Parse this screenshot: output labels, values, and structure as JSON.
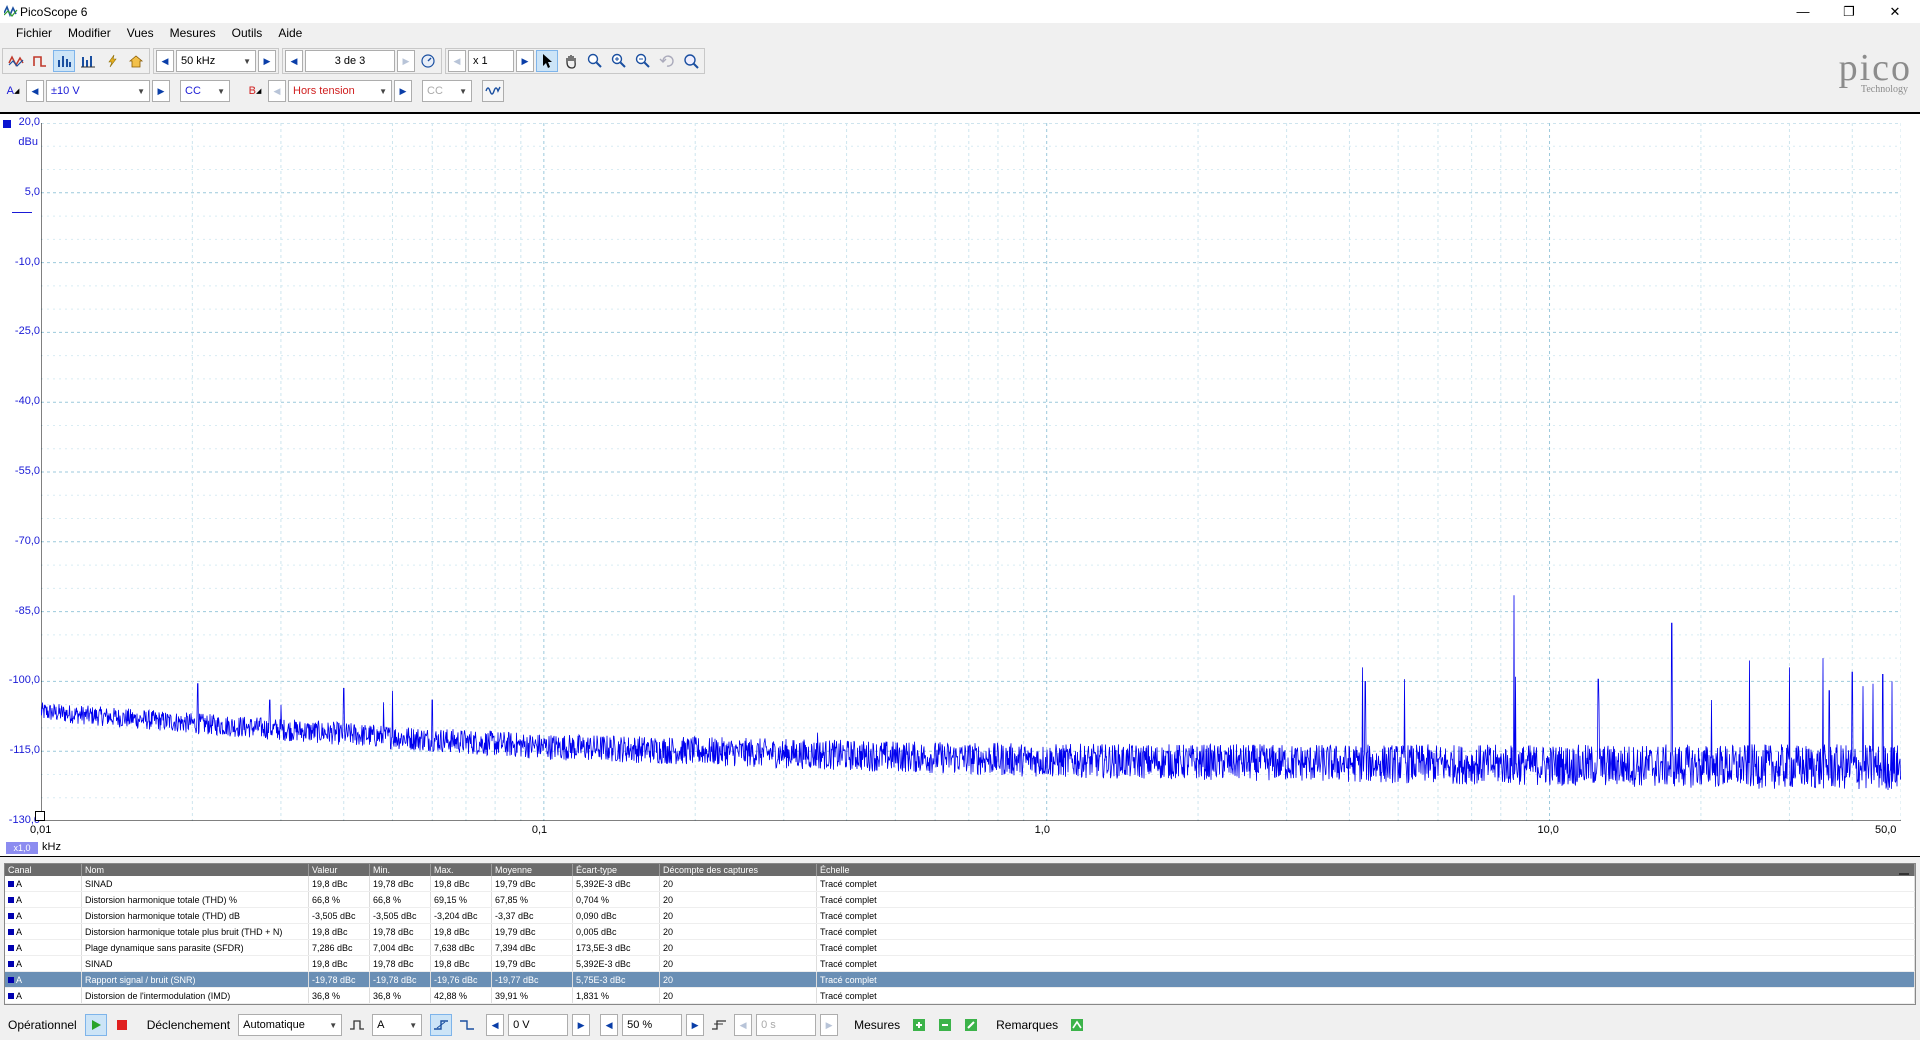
{
  "window": {
    "title": "PicoScope 6",
    "min": "—",
    "restore": "❐",
    "close": "✕"
  },
  "menu": [
    "Fichier",
    "Modifier",
    "Vues",
    "Mesures",
    "Outils",
    "Aide"
  ],
  "toolbar": {
    "timebase": "50 kHz",
    "capture": "3 de 3",
    "zoom": "x 1",
    "logo": "pico",
    "logo_sub": "Technology"
  },
  "channel_a": {
    "label": "A",
    "range": "±10 V",
    "coupling": "CC"
  },
  "channel_b": {
    "label": "B",
    "range": "Hors tension",
    "coupling": "CC"
  },
  "colors": {
    "trace": "#0000ee",
    "axis_text": "#1a1ad6",
    "grid": "#9cc9dc",
    "selected_row": "#6a8fb5"
  },
  "chart_data": {
    "type": "line",
    "ylabel": "dBu",
    "xlabel": "kHz",
    "xscale": "log",
    "xlim": [
      0.01,
      50.0
    ],
    "ylim": [
      -130,
      20
    ],
    "x_ticks": [
      "0,01",
      "0,1",
      "1,0",
      "10,0",
      "50,0"
    ],
    "y_ticks": [
      "20,0",
      "5,0",
      "-10,0",
      "-25,0",
      "-40,0",
      "-55,0",
      "-70,0",
      "-85,0",
      "-100,0",
      "-115,0",
      "-130,0"
    ],
    "y_tick_values": [
      20,
      5,
      -10,
      -25,
      -40,
      -55,
      -70,
      -85,
      -100,
      -115,
      -130
    ],
    "x_tick_values": [
      0.01,
      0.1,
      1.0,
      10.0,
      50.0
    ],
    "scale_badge": "x1,0",
    "series": [
      {
        "noise_floor": [
          [
            0.01,
            -106.5
          ],
          [
            0.02,
            -109
          ],
          [
            0.05,
            -112
          ],
          [
            0.1,
            -114
          ],
          [
            0.3,
            -115.5
          ],
          [
            1.0,
            -117
          ],
          [
            3.0,
            -117.5
          ],
          [
            10.0,
            -118
          ],
          [
            50.0,
            -118.5
          ]
        ],
        "peaks": [
          [
            0.0205,
            -100.5
          ],
          [
            0.03,
            -105
          ],
          [
            0.0285,
            -104
          ],
          [
            0.04,
            -101.5
          ],
          [
            0.048,
            -104.5
          ],
          [
            0.05,
            -102
          ],
          [
            0.06,
            -104
          ],
          [
            0.35,
            -111
          ],
          [
            4.25,
            -97
          ],
          [
            4.3,
            -100
          ],
          [
            5.15,
            -99.5
          ],
          [
            8.5,
            -81.5
          ],
          [
            8.55,
            -99
          ],
          [
            12.5,
            -99.5
          ],
          [
            12.55,
            -105
          ],
          [
            17.5,
            -87.5
          ],
          [
            21.0,
            -104
          ],
          [
            25.0,
            -95.5
          ],
          [
            30.0,
            -97
          ],
          [
            35.0,
            -95
          ],
          [
            36.0,
            -102
          ],
          [
            40.0,
            -98
          ],
          [
            42.0,
            -101
          ],
          [
            44.0,
            -100.5
          ],
          [
            46.0,
            -98.5
          ],
          [
            48.0,
            -100
          ]
        ]
      }
    ]
  },
  "table": {
    "headers": [
      "Canal",
      "Nom",
      "Valeur",
      "Min.",
      "Max.",
      "Moyenne",
      "Écart-type",
      "Décompte des captures",
      "Échelle"
    ],
    "rows": [
      [
        "A",
        "SINAD",
        "19,8 dBc",
        "19,78 dBc",
        "19,8 dBc",
        "19,79 dBc",
        "5,392E-3 dBc",
        "20",
        "Tracé complet"
      ],
      [
        "A",
        "Distorsion harmonique totale (THD) %",
        "66,8 %",
        "66,8 %",
        "69,15 %",
        "67,85 %",
        "0,704 %",
        "20",
        "Tracé complet"
      ],
      [
        "A",
        "Distorsion harmonique totale (THD) dB",
        "-3,505 dBc",
        "-3,505 dBc",
        "-3,204 dBc",
        "-3,37 dBc",
        "0,090 dBc",
        "20",
        "Tracé complet"
      ],
      [
        "A",
        "Distorsion harmonique totale plus bruit (THD + N)",
        "19,8 dBc",
        "19,78 dBc",
        "19,8 dBc",
        "19,79 dBc",
        "0,005 dBc",
        "20",
        "Tracé complet"
      ],
      [
        "A",
        "Plage dynamique sans parasite (SFDR)",
        "7,286 dBc",
        "7,004 dBc",
        "7,638 dBc",
        "7,394 dBc",
        "173,5E-3 dBc",
        "20",
        "Tracé complet"
      ],
      [
        "A",
        "SINAD",
        "19,8 dBc",
        "19,78 dBc",
        "19,8 dBc",
        "19,79 dBc",
        "5,392E-3 dBc",
        "20",
        "Tracé complet"
      ],
      [
        "A",
        "Rapport signal / bruit (SNR)",
        "-19,78 dBc",
        "-19,78 dBc",
        "-19,76 dBc",
        "-19,77 dBc",
        "5,75E-3 dBc",
        "20",
        "Tracé complet"
      ],
      [
        "A",
        "Distorsion de l'intermodulation (IMD)",
        "36,8 %",
        "36,8 %",
        "42,88 %",
        "39,91 %",
        "1,831 %",
        "20",
        "Tracé complet"
      ]
    ],
    "selected_row": 6
  },
  "status": {
    "run_label": "Opérationnel",
    "trigger_label": "Déclenchement",
    "trigger_mode": "Automatique",
    "trigger_source": "A",
    "threshold": "0 V",
    "pretrigger": "50 %",
    "delay": "0 s",
    "measurements": "Mesures",
    "notes": "Remarques"
  }
}
